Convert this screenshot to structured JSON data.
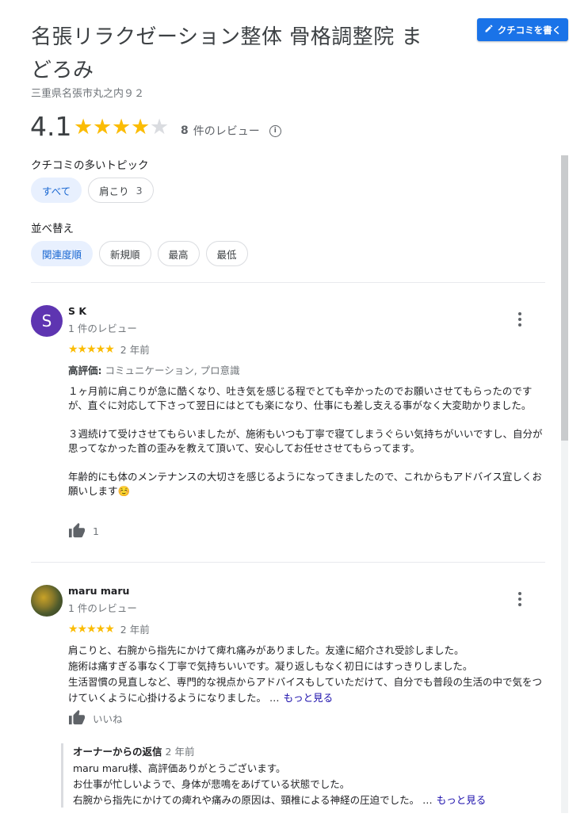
{
  "place": {
    "title": "名張リラクゼーション整体 骨格調整院 まどろみ",
    "address": "三重県名張市丸之内９２",
    "rating": "4.1",
    "stars_filled": 4,
    "stars_total": 5,
    "review_count": "8",
    "review_count_suffix": "件のレビュー",
    "write_review_label": "クチコミを書く"
  },
  "topics": {
    "label": "クチコミの多いトピック",
    "chips": [
      {
        "label": "すべて",
        "count": "",
        "active": true
      },
      {
        "label": "肩こり",
        "count": "3",
        "active": false
      }
    ]
  },
  "sort": {
    "label": "並べ替え",
    "chips": [
      {
        "label": "関連度順",
        "active": true
      },
      {
        "label": "新規順",
        "active": false
      },
      {
        "label": "最高",
        "active": false
      },
      {
        "label": "最低",
        "active": false
      }
    ]
  },
  "reviews": [
    {
      "name": "S K",
      "avatar_letter": "S",
      "avatar_color": "#5e35b1",
      "review_count": "1 件のレビュー",
      "stars": 5,
      "date": "2 年前",
      "highlight_label": "高評価:",
      "highlight_value": "コミュニケーション, プロ意識",
      "body": "１ヶ月前に肩こりが急に酷くなり、吐き気を感じる程でとても辛かったのでお願いさせてもらったのですが、直ぐに対応して下さって翌日にはとても楽になり、仕事にも差し支える事がなく大変助かりました。\n\n３週続けて受けさせてもらいましたが、施術もいつも丁寧で寝てしまうぐらい気持ちがいいですし、自分が思ってなかった首の歪みを教えて頂いて、安心してお任せさせてもらってます。\n\n年齢的にも体のメンテナンスの大切さを感じるようになってきましたので、これからもアドバイス宜しくお願いします☺️",
      "likes": "1"
    },
    {
      "name": "maru maru",
      "review_count": "1 件のレビュー",
      "stars": 5,
      "date": "2 年前",
      "body": "肩こりと、右腕から指先にかけて痺れ痛みがありました。友達に紹介され受診しました。\n施術は痛すぎる事なく丁寧で気持ちいいです。凝り返しもなく初日にはすっきりしました。\n生活習慣の見直しなど、専門的な視点からアドバイスもしていただけて、自分でも普段の生活の中で気をつけていくように心掛けるようになりました。 …",
      "more_label": "もっと見る",
      "like_label": "いいね",
      "owner_reply": {
        "title": "オーナーからの返信",
        "date": "2 年前",
        "body": "maru maru様、高評価ありがとうございます。\nお仕事が忙しいようで、身体が悲鳴をあげている状態でした。\n右腕から指先にかけての痺れや痛みの原因は、頸椎による神経の圧迫でした。 …",
        "more_label": "もっと見る"
      }
    }
  ],
  "colors": {
    "star": "#fbbc04",
    "star_empty": "#dadce0",
    "accent": "#1a73e8",
    "link": "#1a0dab"
  }
}
